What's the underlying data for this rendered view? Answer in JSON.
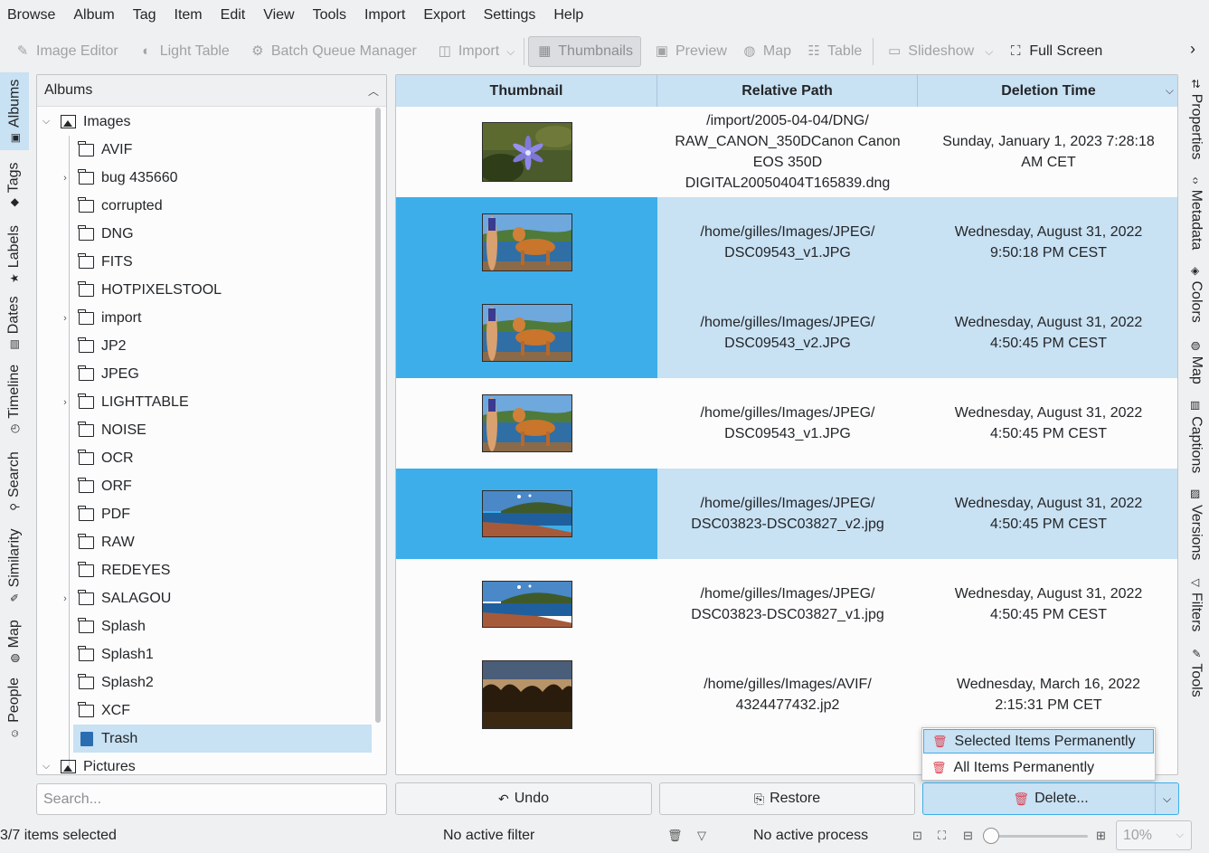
{
  "menu": [
    "Browse",
    "Album",
    "Tag",
    "Item",
    "Edit",
    "View",
    "Tools",
    "Import",
    "Export",
    "Settings",
    "Help"
  ],
  "toolbar": {
    "image_editor": "Image Editor",
    "light_table": "Light Table",
    "batch_queue_manager": "Batch Queue Manager",
    "import": "Import",
    "thumbnails": "Thumbnails",
    "preview": "Preview",
    "map": "Map",
    "table": "Table",
    "slideshow": "Slideshow",
    "full_screen": "Full Screen"
  },
  "left_tabs": [
    "Albums",
    "Tags",
    "Labels",
    "Dates",
    "Timeline",
    "Search",
    "Similarity",
    "Map",
    "People"
  ],
  "right_tabs": [
    "Properties",
    "Metadata",
    "Colors",
    "Map",
    "Captions",
    "Versions",
    "Filters",
    "Tools"
  ],
  "albums": {
    "title": "Albums",
    "root": "Images",
    "folders": [
      "AVIF",
      "bug 435660",
      "corrupted",
      "DNG",
      "FITS",
      "HOTPIXELSTOOL",
      "import",
      "JP2",
      "JPEG",
      "LIGHTTABLE",
      "NOISE",
      "OCR",
      "ORF",
      "PDF",
      "RAW",
      "REDEYES",
      "SALAGOU",
      "Splash",
      "Splash1",
      "Splash2",
      "XCF",
      "Trash"
    ],
    "second_root": "Pictures"
  },
  "search": {
    "placeholder": "Search..."
  },
  "table": {
    "headers": [
      "Thumbnail",
      "Relative Path",
      "Deletion Time"
    ],
    "rows": [
      {
        "path_l1": "/import/2005-04-04/DNG/",
        "path_l2": "RAW_CANON_350DCanon Canon",
        "path_l3": "EOS 350D",
        "path_l4": "DIGITAL20050404T165839.dng",
        "time_l1": "Sunday, January 1, 2023 7:28:18",
        "time_l2": "AM CET",
        "selected": false
      },
      {
        "path_l1": "/home/gilles/Images/JPEG/",
        "path_l2": "DSC09543_v1.JPG",
        "time_l1": "Wednesday, August 31, 2022",
        "time_l2": "9:50:18 PM CEST",
        "selected": true
      },
      {
        "path_l1": "/home/gilles/Images/JPEG/",
        "path_l2": "DSC09543_v2.JPG",
        "time_l1": "Wednesday, August 31, 2022",
        "time_l2": "4:50:45 PM CEST",
        "selected": true
      },
      {
        "path_l1": "/home/gilles/Images/JPEG/",
        "path_l2": "DSC09543_v1.JPG",
        "time_l1": "Wednesday, August 31, 2022",
        "time_l2": "4:50:45 PM CEST",
        "selected": false
      },
      {
        "path_l1": "/home/gilles/Images/JPEG/",
        "path_l2": "DSC03823-DSC03827_v2.jpg",
        "time_l1": "Wednesday, August 31, 2022",
        "time_l2": "4:50:45 PM CEST",
        "selected": true
      },
      {
        "path_l1": "/home/gilles/Images/JPEG/",
        "path_l2": "DSC03823-DSC03827_v1.jpg",
        "time_l1": "Wednesday, August 31, 2022",
        "time_l2": "4:50:45 PM CEST",
        "selected": false
      },
      {
        "path_l1": "/home/gilles/Images/AVIF/",
        "path_l2": "4324477432.jp2",
        "time_l1": "Wednesday, March 16, 2022",
        "time_l2": "2:15:31 PM CET",
        "selected": false
      }
    ]
  },
  "buttons": {
    "undo": "Undo",
    "restore": "Restore",
    "delete": "Delete..."
  },
  "popup": {
    "selected_permanently": "Selected Items Permanently",
    "all_permanently": "All Items Permanently"
  },
  "status": {
    "selection": "3/7 items selected",
    "filter": "No active filter",
    "process": "No active process",
    "zoom": "10%"
  },
  "colors": {
    "selection_blue": "#3daee9",
    "selection_light": "#c8e1f3",
    "delete_red": "#da4453"
  }
}
